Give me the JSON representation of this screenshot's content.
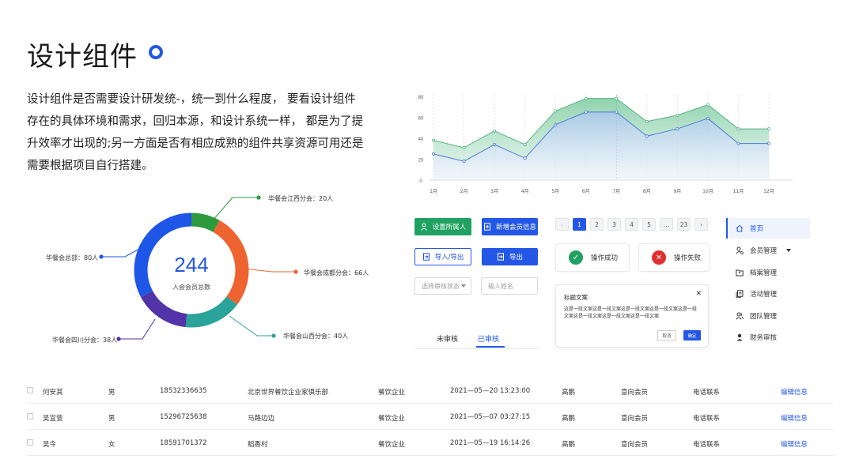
{
  "header": {
    "title": "设计组件"
  },
  "intro_lines": [
    "设计组件是否需要设计研发统-，统一到什么程度， 要看设计组件",
    "存在的具体环境和需求，回归本源，和设计系统一样， 都是为了提",
    "升效率才出现的;另一方面是否有相应成熟的组件共享资源可用还是",
    "需要根据项目自行搭建。"
  ],
  "donut": {
    "total": "244",
    "total_label": "入会会员总数",
    "segments": [
      {
        "label": "华餐会江西分会：20人",
        "value": 20,
        "color": "#2c9a3c"
      },
      {
        "label": "华餐会成都分会：66人",
        "value": 66,
        "color": "#ee6431"
      },
      {
        "label": "华餐会山西分会：40人",
        "value": 40,
        "color": "#2aa39a"
      },
      {
        "label": "华餐会四川分会：38人",
        "value": 38,
        "color": "#5233a8"
      },
      {
        "label": "华餐会总部：80人",
        "value": 80,
        "color": "#1e56e8"
      }
    ]
  },
  "chart_data": {
    "type": "area",
    "categories": [
      "1月",
      "2月",
      "3月",
      "4月",
      "5月",
      "6月",
      "7月",
      "8月",
      "9月",
      "10月",
      "11月",
      "12月"
    ],
    "series": [
      {
        "values": [
          38,
          31,
          47,
          34,
          66,
          78,
          78,
          56,
          62,
          72,
          49,
          49
        ],
        "color": "#58b486"
      },
      {
        "values": [
          25,
          18,
          34,
          21,
          53,
          65,
          65,
          42,
          49,
          59,
          35,
          35
        ],
        "color": "#4a78d8"
      }
    ],
    "ylim": [
      0,
      80
    ],
    "yticks": [
      0,
      20,
      40,
      60,
      80
    ],
    "grid": "vertical-dashed"
  },
  "buttons": {
    "set_owner": "设置所属人",
    "add_member": "新增会员信息",
    "import_export": "导入/导出",
    "export": "导出"
  },
  "fields": {
    "review_status_placeholder": "选择审核状态",
    "name_placeholder": "输入姓名"
  },
  "tabs": [
    "未审核",
    "已审核"
  ],
  "pagination": [
    "1",
    "2",
    "3",
    "4",
    "5",
    "...",
    "23"
  ],
  "status": {
    "success": "操作成功",
    "fail": "操作失败"
  },
  "dialog": {
    "title": "标题文案",
    "body": "这是一段文案这是一段文案这是一段文案这是一段文案这是一段文案这是一段文案这是一段文案这是一段文案",
    "cancel": "取消",
    "ok": "确定"
  },
  "menu": [
    "首页",
    "会员管理",
    "档案管理",
    "活动管理",
    "团队管理",
    "财务审核"
  ],
  "table": {
    "rows": [
      [
        "何安其",
        "男",
        "18532336635",
        "北京世界餐饮企业家俱乐部",
        "餐饮企业",
        "2021—05—20  13:23:00",
        "高鹏",
        "意向会员",
        "电话联系",
        "编辑信息"
      ],
      [
        "吴宜萱",
        "男",
        "15296725638",
        "马路边边",
        "餐饮企业",
        "2021—05—07 03:27:15",
        "高鹏",
        "意向会员",
        "电话联系",
        "编辑信息"
      ],
      [
        "吴今",
        "女",
        "18591701372",
        "稻香村",
        "餐饮企业",
        "2021—05—19 16:14:26",
        "高鹏",
        "意向会员",
        "电话联系",
        "编辑信息"
      ]
    ]
  },
  "colors": {
    "primary": "#2457e6",
    "success": "#20a162",
    "danger": "#e0302e"
  }
}
